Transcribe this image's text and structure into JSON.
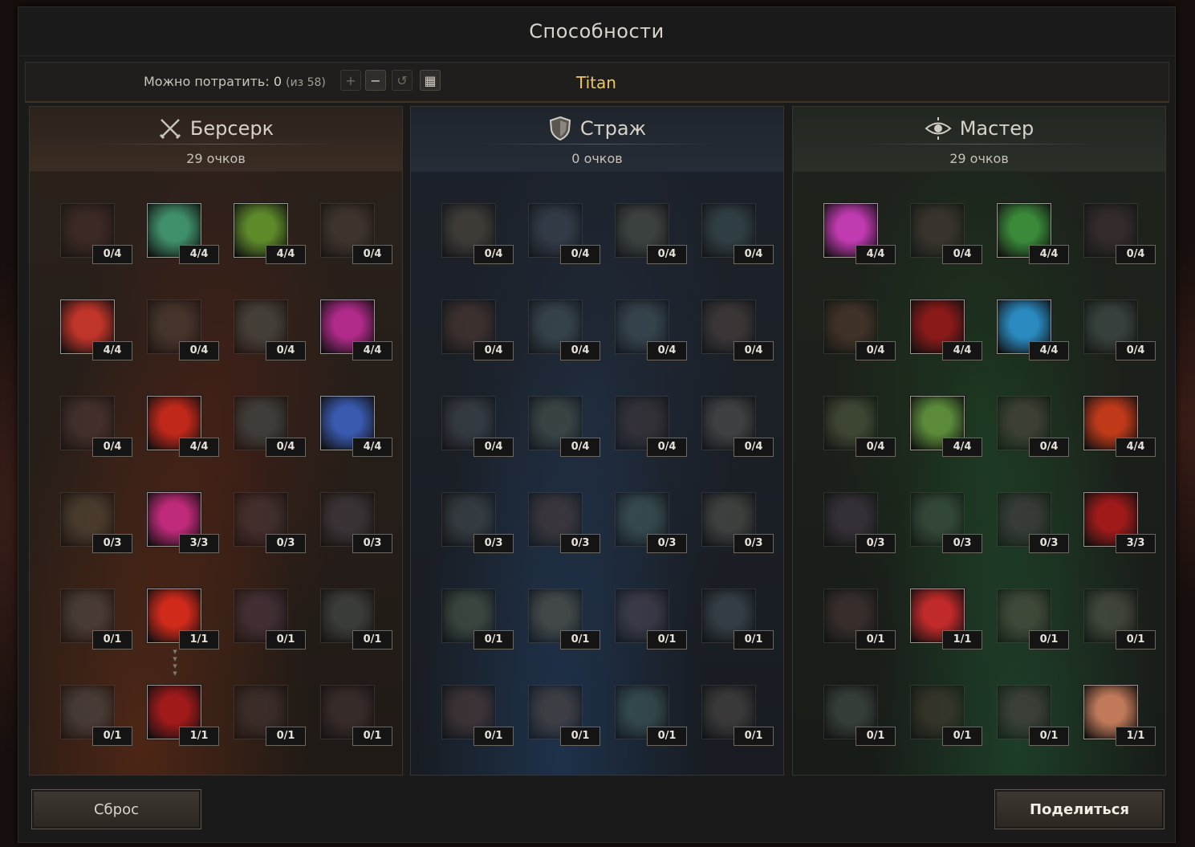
{
  "window": {
    "title": "Способности"
  },
  "info": {
    "spend_label": "Можно потратить:",
    "spend_value": "0",
    "spend_of": "(из 58)",
    "class_name": "Titan",
    "buttons": [
      {
        "icon": "plus-icon",
        "glyph": "+"
      },
      {
        "icon": "minus-icon",
        "glyph": "−"
      },
      {
        "icon": "undo-icon",
        "glyph": "↺"
      },
      {
        "icon": "calculator-icon",
        "glyph": "▦"
      }
    ]
  },
  "colors": {
    "accent_gold": "#f0c85a",
    "berserk": "#b04a2a",
    "guard": "#3f6a9e",
    "master": "#3f8a4a"
  },
  "trees": [
    {
      "name": "Берсерк",
      "icon": "crossed-swords-icon",
      "points": "29 очков",
      "theme": "berserk",
      "skills": [
        {
          "rank": "0/4",
          "active": false,
          "color": "#7a2a22"
        },
        {
          "rank": "4/4",
          "active": true,
          "color": "#3f8f6a"
        },
        {
          "rank": "4/4",
          "active": true,
          "color": "#5f8a2a"
        },
        {
          "rank": "0/4",
          "active": false,
          "color": "#6a4a3a"
        },
        {
          "rank": "4/4",
          "active": true,
          "color": "#c0352a"
        },
        {
          "rank": "0/4",
          "active": false,
          "color": "#6a4a34"
        },
        {
          "rank": "0/4",
          "active": false,
          "color": "#4a6a5a"
        },
        {
          "rank": "4/4",
          "active": true,
          "color": "#b02a8a"
        },
        {
          "rank": "0/4",
          "active": false,
          "color": "#7a3a3a"
        },
        {
          "rank": "4/4",
          "active": true,
          "color": "#c0281a"
        },
        {
          "rank": "0/4",
          "active": false,
          "color": "#2a6a6a"
        },
        {
          "rank": "4/4",
          "active": true,
          "color": "#3a5ab0"
        },
        {
          "rank": "0/3",
          "active": false,
          "color": "#6a5a2a"
        },
        {
          "rank": "3/3",
          "active": true,
          "color": "#c02a7a"
        },
        {
          "rank": "0/3",
          "active": false,
          "color": "#6a3a4a"
        },
        {
          "rank": "0/3",
          "active": false,
          "color": "#5a4a6a"
        },
        {
          "rank": "0/1",
          "active": false,
          "color": "#5a5a5a"
        },
        {
          "rank": "1/1",
          "active": true,
          "color": "#d02a1a"
        },
        {
          "rank": "0/1",
          "active": false,
          "color": "#6a3a6a"
        },
        {
          "rank": "0/1",
          "active": false,
          "color": "#4a6a5a"
        },
        {
          "rank": "0/1",
          "active": false,
          "color": "#4a5a6a"
        },
        {
          "rank": "1/1",
          "active": true,
          "color": "#a01a1a"
        },
        {
          "rank": "0/1",
          "active": false,
          "color": "#5a3a3a"
        },
        {
          "rank": "0/1",
          "active": false,
          "color": "#6a3a3a"
        }
      ]
    },
    {
      "name": "Страж",
      "icon": "shield-icon",
      "points": "0 очков",
      "theme": "guard",
      "skills": [
        {
          "rank": "0/4",
          "active": false,
          "color": "#7a5a2a"
        },
        {
          "rank": "0/4",
          "active": false,
          "color": "#3a5a7a"
        },
        {
          "rank": "0/4",
          "active": false,
          "color": "#5a6a3a"
        },
        {
          "rank": "0/4",
          "active": false,
          "color": "#2a6a6a"
        },
        {
          "rank": "0/4",
          "active": false,
          "color": "#8a3a1a"
        },
        {
          "rank": "0/4",
          "active": false,
          "color": "#3a6a6a"
        },
        {
          "rank": "0/4",
          "active": false,
          "color": "#3a6a7a"
        },
        {
          "rank": "0/4",
          "active": false,
          "color": "#7a4a3a"
        },
        {
          "rank": "0/4",
          "active": false,
          "color": "#4a5a6a"
        },
        {
          "rank": "0/4",
          "active": false,
          "color": "#4a6a3a"
        },
        {
          "rank": "0/4",
          "active": false,
          "color": "#5a3a3a"
        },
        {
          "rank": "0/4",
          "active": false,
          "color": "#6a6a5a"
        },
        {
          "rank": "0/3",
          "active": false,
          "color": "#4a5a5a"
        },
        {
          "rank": "0/3",
          "active": false,
          "color": "#7a3a2a"
        },
        {
          "rank": "0/3",
          "active": false,
          "color": "#2a7a6a"
        },
        {
          "rank": "0/3",
          "active": false,
          "color": "#6a6a4a"
        },
        {
          "rank": "0/1",
          "active": false,
          "color": "#4a7a2a"
        },
        {
          "rank": "0/1",
          "active": false,
          "color": "#7a6a2a"
        },
        {
          "rank": "0/1",
          "active": false,
          "color": "#6a4a6a"
        },
        {
          "rank": "0/1",
          "active": false,
          "color": "#3a6a7a"
        },
        {
          "rank": "0/1",
          "active": false,
          "color": "#8a3a2a"
        },
        {
          "rank": "0/1",
          "active": false,
          "color": "#7a4a2a"
        },
        {
          "rank": "0/1",
          "active": false,
          "color": "#2a7a6a"
        },
        {
          "rank": "0/1",
          "active": false,
          "color": "#6a5a4a"
        }
      ]
    },
    {
      "name": "Мастер",
      "icon": "eye-icon",
      "points": "29 очков",
      "theme": "master",
      "skills": [
        {
          "rank": "4/4",
          "active": true,
          "color": "#c03ab0"
        },
        {
          "rank": "0/4",
          "active": false,
          "color": "#7a3a3a"
        },
        {
          "rank": "4/4",
          "active": true,
          "color": "#3a8a3a"
        },
        {
          "rank": "0/4",
          "active": false,
          "color": "#6a2a4a"
        },
        {
          "rank": "0/4",
          "active": false,
          "color": "#9a3a1a"
        },
        {
          "rank": "4/4",
          "active": true,
          "color": "#8a1a1a"
        },
        {
          "rank": "4/4",
          "active": true,
          "color": "#2a8ac0"
        },
        {
          "rank": "0/4",
          "active": false,
          "color": "#4a6a6a"
        },
        {
          "rank": "0/4",
          "active": false,
          "color": "#5a7a2a"
        },
        {
          "rank": "4/4",
          "active": true,
          "color": "#5a8a3a"
        },
        {
          "rank": "0/4",
          "active": false,
          "color": "#7a4a3a"
        },
        {
          "rank": "4/4",
          "active": true,
          "color": "#c03a1a"
        },
        {
          "rank": "0/3",
          "active": false,
          "color": "#6a3a7a"
        },
        {
          "rank": "0/3",
          "active": false,
          "color": "#3a6a4a"
        },
        {
          "rank": "0/3",
          "active": false,
          "color": "#6a3a5a"
        },
        {
          "rank": "3/3",
          "active": true,
          "color": "#a01a1a"
        },
        {
          "rank": "0/1",
          "active": false,
          "color": "#7a3a3a"
        },
        {
          "rank": "1/1",
          "active": true,
          "color": "#c02a2a"
        },
        {
          "rank": "0/1",
          "active": false,
          "color": "#7a5a3a"
        },
        {
          "rank": "0/1",
          "active": false,
          "color": "#6a6a4a"
        },
        {
          "rank": "0/1",
          "active": false,
          "color": "#4a6a5a"
        },
        {
          "rank": "0/1",
          "active": false,
          "color": "#6a3a1a"
        },
        {
          "rank": "0/1",
          "active": false,
          "color": "#7a3a4a"
        },
        {
          "rank": "1/1",
          "active": true,
          "color": "#c07a5a"
        }
      ]
    }
  ],
  "footer": {
    "reset_label": "Сброс",
    "share_label": "Поделиться"
  }
}
